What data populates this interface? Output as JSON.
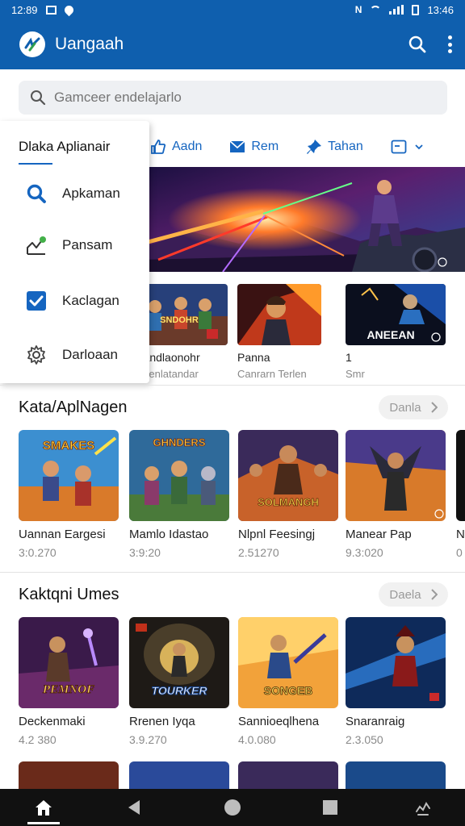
{
  "status_bar": {
    "time_left": "12:89",
    "time_right": "13:46"
  },
  "app_bar": {
    "title": "Uangaah"
  },
  "search": {
    "placeholder": "Gamceer endelajarlo"
  },
  "top_tabs": [
    {
      "label": "Aadn",
      "icon": "thumbs-up-icon"
    },
    {
      "label": "Rem",
      "icon": "mail-icon"
    },
    {
      "label": "Tahan",
      "icon": "pin-icon"
    }
  ],
  "drawer": {
    "title": "Dlaka Aplianair",
    "items": [
      {
        "label": "Apkaman",
        "icon": "search-icon"
      },
      {
        "label": "Pansam",
        "icon": "chart-icon"
      },
      {
        "label": "Kaclagan",
        "icon": "checkbox-icon"
      },
      {
        "label": "Darloaan",
        "icon": "settings-icon"
      }
    ]
  },
  "featured_row": [
    {
      "title": "enandlaonohr",
      "subtitle": "kApenlatandar",
      "thumb_text": "SNDOHR"
    },
    {
      "title": "Panna",
      "subtitle": "Canrarn Terlen",
      "thumb_text": ""
    },
    {
      "title": "1",
      "subtitle": "Smr",
      "thumb_text": "ANEEAN"
    }
  ],
  "sections": [
    {
      "title": "Kata/AplNagen",
      "more_label": "Danla",
      "cards": [
        {
          "title": "Uannan Eargesi",
          "meta": "3:0.270",
          "thumb_text": "SMAKES"
        },
        {
          "title": "Mamlo Idastao",
          "meta": "3:9:20",
          "thumb_text": "GHNDERS"
        },
        {
          "title": "Nlpnl Feesingj",
          "meta": "2.51270",
          "thumb_text": "SOLMANGH"
        },
        {
          "title": "Manear Pap",
          "meta": "9.3:020",
          "thumb_text": ""
        },
        {
          "title": "N",
          "meta": "0",
          "thumb_text": ""
        }
      ]
    },
    {
      "title": "Kaktqni Umes",
      "more_label": "Daela",
      "cards": [
        {
          "title": "Deckenmaki",
          "meta": "4.2 380",
          "thumb_text": "PEMNOF"
        },
        {
          "title": "Rrenen Iyqa",
          "meta": "3.9.270",
          "thumb_text": "TOURKER"
        },
        {
          "title": "Sannioeqlhena",
          "meta": "4.0.080",
          "thumb_text": "SONGEB"
        },
        {
          "title": "Snaranraig",
          "meta": "2.3.050",
          "thumb_text": ""
        }
      ]
    }
  ],
  "colors": {
    "primary": "#0f5fae",
    "accent": "#1565c0",
    "navbar": "#111111"
  }
}
